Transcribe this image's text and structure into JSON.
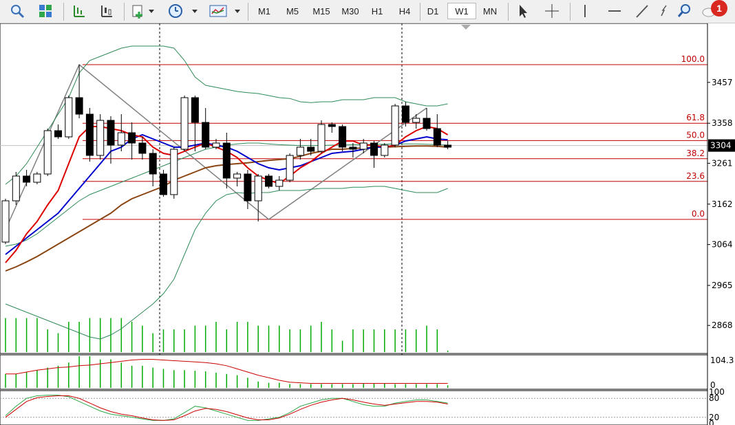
{
  "toolbar": {
    "timeframes": [
      "M1",
      "M5",
      "M15",
      "M30",
      "H1",
      "H4",
      "D1",
      "W1",
      "MN"
    ],
    "selected_timeframe": "W1",
    "notification_count": "1"
  },
  "main_axis": {
    "ticks": [
      "3457",
      "3358",
      "3261",
      "3162",
      "3064",
      "2965",
      "2868"
    ],
    "current_price": "3304"
  },
  "fibonacci": {
    "levels": [
      "100.0",
      "61.8",
      "50.0",
      "38.2",
      "23.6",
      "0.0"
    ]
  },
  "osc1": {
    "ticks": [
      "104.3",
      "0"
    ]
  },
  "osc2": {
    "ticks": [
      "80",
      "100",
      "20",
      "0"
    ]
  },
  "colors": {
    "up": "#ffffff",
    "down": "#000000",
    "fast_ma": "#dd0000",
    "mid_ma": "#0000cc",
    "slow_ma": "#8b4513",
    "bands": "#2e8b57",
    "volume": "#00aa00",
    "fib": "#c00000",
    "zigzag": "#808080"
  },
  "chart_data": {
    "type": "candlestick",
    "y_range": [
      2800,
      3600
    ],
    "candles": [
      [
        3070,
        3170,
        3065,
        3175
      ],
      [
        3170,
        3230,
        3160,
        3240
      ],
      [
        3230,
        3215,
        3205,
        3245
      ],
      [
        3215,
        3235,
        3210,
        3240
      ],
      [
        3235,
        3340,
        3230,
        3345
      ],
      [
        3340,
        3325,
        3320,
        3355
      ],
      [
        3325,
        3420,
        3320,
        3425
      ],
      [
        3420,
        3380,
        3370,
        3500
      ],
      [
        3380,
        3280,
        3265,
        3395
      ],
      [
        3280,
        3365,
        3270,
        3380
      ],
      [
        3365,
        3305,
        3260,
        3375
      ],
      [
        3305,
        3335,
        3290,
        3380
      ],
      [
        3335,
        3310,
        3270,
        3360
      ],
      [
        3310,
        3285,
        3270,
        3325
      ],
      [
        3285,
        3235,
        3205,
        3295
      ],
      [
        3235,
        3185,
        3180,
        3245
      ],
      [
        3185,
        3295,
        3175,
        3300
      ],
      [
        3295,
        3420,
        3290,
        3425
      ],
      [
        3420,
        3360,
        3290,
        3425
      ],
      [
        3360,
        3300,
        3295,
        3395
      ],
      [
        3300,
        3310,
        3295,
        3320
      ],
      [
        3310,
        3225,
        3200,
        3335
      ],
      [
        3225,
        3235,
        3205,
        3240
      ],
      [
        3235,
        3170,
        3150,
        3245
      ],
      [
        3170,
        3230,
        3120,
        3235
      ],
      [
        3230,
        3205,
        3200,
        3235
      ],
      [
        3205,
        3220,
        3195,
        3230
      ],
      [
        3220,
        3280,
        3215,
        3285
      ],
      [
        3280,
        3300,
        3270,
        3320
      ],
      [
        3300,
        3290,
        3280,
        3320
      ],
      [
        3290,
        3355,
        3285,
        3365
      ],
      [
        3355,
        3350,
        3335,
        3360
      ],
      [
        3350,
        3300,
        3290,
        3355
      ],
      [
        3300,
        3295,
        3275,
        3310
      ],
      [
        3295,
        3310,
        3285,
        3320
      ],
      [
        3310,
        3280,
        3250,
        3315
      ],
      [
        3280,
        3305,
        3275,
        3310
      ],
      [
        3305,
        3400,
        3300,
        3405
      ],
      [
        3400,
        3360,
        3350,
        3410
      ],
      [
        3360,
        3370,
        3345,
        3380
      ],
      [
        3370,
        3345,
        3340,
        3395
      ],
      [
        3345,
        3305,
        3300,
        3380
      ],
      [
        3305,
        3300,
        3295,
        3315
      ]
    ],
    "fast_ma": [
      3020,
      3050,
      3090,
      3120,
      3160,
      3195,
      3260,
      3325,
      3350,
      3350,
      3345,
      3340,
      3330,
      3325,
      3300,
      3285,
      3280,
      3290,
      3300,
      3310,
      3300,
      3290,
      3275,
      3250,
      3230,
      3220,
      3212,
      3230,
      3250,
      3265,
      3285,
      3300,
      3315,
      3315,
      3305,
      3305,
      3300,
      3305,
      3325,
      3340,
      3350,
      3345,
      3330
    ],
    "mid_ma": [
      3040,
      3060,
      3080,
      3100,
      3120,
      3140,
      3170,
      3200,
      3230,
      3260,
      3290,
      3300,
      3320,
      3330,
      3320,
      3310,
      3300,
      3300,
      3305,
      3310,
      3305,
      3300,
      3290,
      3275,
      3260,
      3250,
      3245,
      3250,
      3255,
      3265,
      3275,
      3285,
      3288,
      3290,
      3295,
      3300,
      3300,
      3305,
      3315,
      3320,
      3325,
      3320,
      3318
    ],
    "slow_ma": [
      3000,
      3010,
      3022,
      3035,
      3050,
      3065,
      3080,
      3095,
      3110,
      3125,
      3140,
      3160,
      3175,
      3185,
      3195,
      3205,
      3220,
      3230,
      3240,
      3250,
      3255,
      3258,
      3260,
      3262,
      3265,
      3268,
      3270,
      3272,
      3278,
      3285,
      3290,
      3295,
      3295,
      3297,
      3298,
      3300,
      3300,
      3301,
      3302,
      3303,
      3303,
      3302,
      3300
    ],
    "upper_band": [
      3210,
      3230,
      3260,
      3300,
      3340,
      3380,
      3420,
      3480,
      3510,
      3520,
      3530,
      3540,
      3545,
      3545,
      3545,
      3545,
      3540,
      3510,
      3470,
      3450,
      3445,
      3440,
      3435,
      3432,
      3430,
      3425,
      3420,
      3418,
      3410,
      3408,
      3410,
      3410,
      3415,
      3415,
      3415,
      3420,
      3420,
      3420,
      3410,
      3405,
      3400,
      3400,
      3405
    ],
    "lower_band": [
      2920,
      2910,
      2900,
      2890,
      2880,
      2870,
      2860,
      2850,
      2840,
      2835,
      2845,
      2860,
      2880,
      2900,
      2920,
      2945,
      2980,
      3040,
      3100,
      3140,
      3170,
      3185,
      3190,
      3188,
      3190,
      3190,
      3195,
      3195,
      3195,
      3198,
      3200,
      3200,
      3200,
      3203,
      3203,
      3205,
      3205,
      3200,
      3195,
      3190,
      3190,
      3190,
      3200
    ],
    "mid_band": [
      3060,
      3065,
      3075,
      3090,
      3110,
      3130,
      3150,
      3170,
      3185,
      3195,
      3205,
      3215,
      3225,
      3235,
      3245,
      3255,
      3265,
      3275,
      3285,
      3295,
      3300,
      3305,
      3308,
      3310,
      3310,
      3308,
      3306,
      3305,
      3304,
      3304,
      3304,
      3305,
      3305,
      3306,
      3306,
      3307,
      3307,
      3308,
      3308,
      3308,
      3307,
      3306,
      3305
    ],
    "volume": [
      45,
      45,
      45,
      45,
      30,
      25,
      40,
      40,
      45,
      45,
      45,
      45,
      40,
      35,
      25,
      30,
      30,
      30,
      35,
      35,
      40,
      30,
      40,
      40,
      35,
      35,
      35,
      30,
      30,
      35,
      40,
      30,
      15,
      30,
      30,
      30,
      30,
      30,
      30,
      30,
      35,
      30,
      2
    ],
    "fib_levels": [
      100.0,
      61.8,
      50.0,
      38.2,
      23.6,
      0.0
    ],
    "fib_prices": [
      3500,
      3358,
      3316,
      3272,
      3217,
      3125
    ],
    "osc1_hist": [
      22,
      22,
      25,
      28,
      32,
      35,
      40,
      50,
      50,
      45,
      45,
      40,
      35,
      35,
      32,
      30,
      28,
      28,
      27,
      26,
      24,
      22,
      20,
      16,
      10,
      8,
      8,
      6,
      6,
      6,
      6,
      6,
      6,
      6,
      7,
      7,
      7,
      6,
      6,
      6,
      6,
      6,
      4
    ],
    "osc1_line": [
      22,
      22,
      25,
      28,
      30,
      32,
      33,
      35,
      36,
      38,
      40,
      42,
      44,
      45,
      45,
      44,
      43,
      42,
      41,
      40,
      38,
      35,
      30,
      25,
      20,
      16,
      12,
      9,
      8,
      7,
      7,
      7,
      7,
      7,
      7,
      7,
      7,
      7,
      7,
      7,
      7,
      7,
      7
    ],
    "osc2_k": [
      25,
      55,
      80,
      88,
      90,
      90,
      85,
      70,
      55,
      40,
      30,
      25,
      20,
      15,
      10,
      10,
      15,
      35,
      55,
      50,
      40,
      30,
      20,
      10,
      10,
      15,
      20,
      35,
      55,
      65,
      75,
      80,
      80,
      70,
      60,
      55,
      55,
      65,
      70,
      75,
      75,
      70,
      65
    ],
    "osc2_d": [
      20,
      45,
      70,
      82,
      86,
      88,
      88,
      80,
      65,
      50,
      38,
      30,
      25,
      18,
      12,
      10,
      12,
      25,
      40,
      48,
      45,
      38,
      28,
      18,
      12,
      12,
      18,
      30,
      45,
      58,
      68,
      75,
      80,
      75,
      68,
      62,
      58,
      62,
      66,
      70,
      70,
      68,
      62
    ]
  }
}
